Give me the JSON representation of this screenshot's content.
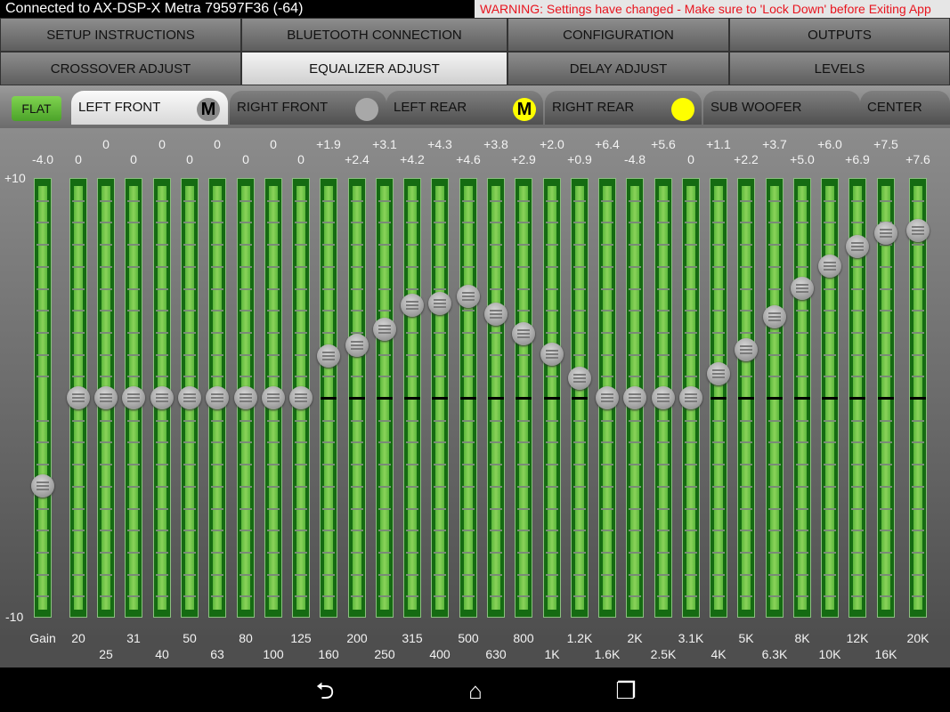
{
  "status": {
    "connection": "Connected to AX-DSP-X Metra 79597F36 (-64)",
    "warning": "WARNING: Settings have changed - Make sure to 'Lock Down' before Exiting App",
    "warning_color": "#e8141e"
  },
  "nav": [
    {
      "label": "SETUP INSTRUCTIONS",
      "active": false
    },
    {
      "label": "BLUETOOTH CONNECTION",
      "active": false
    },
    {
      "label": "CONFIGURATION",
      "active": false
    },
    {
      "label": "OUTPUTS",
      "active": false
    },
    {
      "label": "CROSSOVER ADJUST",
      "active": false
    },
    {
      "label": "EQUALIZER ADJUST",
      "active": true
    },
    {
      "label": "DELAY ADJUST",
      "active": false
    },
    {
      "label": "LEVELS",
      "active": false
    }
  ],
  "flat_label": "FLAT",
  "channels": [
    {
      "label": "LEFT FRONT",
      "active": true,
      "indicator": "M",
      "indicator_color": "#8a8a8a"
    },
    {
      "label": "RIGHT FRONT",
      "active": false,
      "indicator": "",
      "indicator_color": "#a8a8a8"
    },
    {
      "label": "LEFT REAR",
      "active": false,
      "indicator": "M",
      "indicator_color": "#ffff00"
    },
    {
      "label": "RIGHT REAR",
      "active": false,
      "indicator": "",
      "indicator_color": "#ffff00"
    },
    {
      "label": "SUB WOOFER",
      "active": false,
      "indicator": null
    },
    {
      "label": "CENTER",
      "active": false,
      "indicator": null
    }
  ],
  "scale": {
    "max": "+10",
    "min": "-10"
  },
  "bands": [
    {
      "freq": "Gain",
      "label": "-4.0",
      "level": -4.0
    },
    {
      "freq": "20",
      "label": "0",
      "level": 0
    },
    {
      "freq": "25",
      "label": "0",
      "level": 0
    },
    {
      "freq": "31",
      "label": "0",
      "level": 0
    },
    {
      "freq": "40",
      "label": "0",
      "level": 0
    },
    {
      "freq": "50",
      "label": "0",
      "level": 0
    },
    {
      "freq": "63",
      "label": "0",
      "level": 0
    },
    {
      "freq": "80",
      "label": "0",
      "level": 0
    },
    {
      "freq": "100",
      "label": "0",
      "level": 0
    },
    {
      "freq": "125",
      "label": "0",
      "level": 0
    },
    {
      "freq": "160",
      "label": "+1.9",
      "level": 1.9
    },
    {
      "freq": "200",
      "label": "+2.4",
      "level": 2.4
    },
    {
      "freq": "250",
      "label": "+3.1",
      "level": 3.1
    },
    {
      "freq": "315",
      "label": "+4.2",
      "level": 4.2
    },
    {
      "freq": "400",
      "label": "+4.3",
      "level": 4.3
    },
    {
      "freq": "500",
      "label": "+4.6",
      "level": 4.6
    },
    {
      "freq": "630",
      "label": "+3.8",
      "level": 3.8
    },
    {
      "freq": "800",
      "label": "+2.9",
      "level": 2.9
    },
    {
      "freq": "1K",
      "label": "+2.0",
      "level": 2.0
    },
    {
      "freq": "1.2K",
      "label": "+0.9",
      "level": 0.9
    },
    {
      "freq": "1.6K",
      "label": "+6.4",
      "level": 0
    },
    {
      "freq": "2K",
      "label": "-4.8",
      "level": 0
    },
    {
      "freq": "2.5K",
      "label": "+5.6",
      "level": 0
    },
    {
      "freq": "3.1K",
      "label": "0",
      "level": 0
    },
    {
      "freq": "4K",
      "label": "+1.1",
      "level": 1.1
    },
    {
      "freq": "5K",
      "label": "+2.2",
      "level": 2.2
    },
    {
      "freq": "6.3K",
      "label": "+3.7",
      "level": 3.7
    },
    {
      "freq": "8K",
      "label": "+5.0",
      "level": 5.0
    },
    {
      "freq": "10K",
      "label": "+6.0",
      "level": 6.0
    },
    {
      "freq": "12K",
      "label": "+6.9",
      "level": 6.9
    },
    {
      "freq": "16K",
      "label": "+7.5",
      "level": 7.5
    },
    {
      "freq": "20K",
      "label": "+7.6",
      "level": 7.6
    }
  ],
  "system_nav": [
    {
      "name": "back-icon",
      "glyph": "⮌"
    },
    {
      "name": "home-icon",
      "glyph": "⌂"
    },
    {
      "name": "recents-icon",
      "glyph": "❐"
    }
  ]
}
